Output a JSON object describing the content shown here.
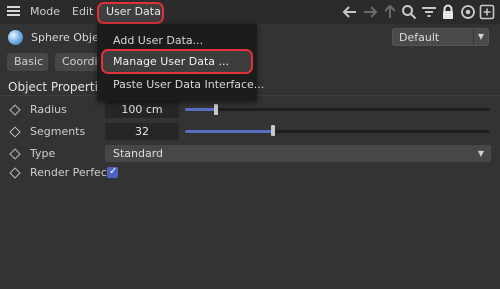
{
  "menubar": {
    "items": [
      {
        "label": "Mode"
      },
      {
        "label": "Edit"
      },
      {
        "label": "User Data"
      }
    ],
    "toolbar_icons": [
      "arrow-left-icon",
      "arrow-right-icon",
      "arrow-up-icon",
      "search-icon",
      "filter-icon",
      "lock-icon",
      "target-icon",
      "add-window-icon"
    ]
  },
  "object": {
    "icon": "sphere-icon",
    "name": "Sphere Object"
  },
  "mode_dropdown": {
    "value": "Default"
  },
  "tabs": [
    {
      "label": "Basic"
    },
    {
      "label": "Coordin"
    }
  ],
  "section": {
    "title": "Object Properties"
  },
  "properties": {
    "radius": {
      "label": "Radius",
      "value": "100 cm",
      "slider_fraction": 0.1
    },
    "segments": {
      "label": "Segments",
      "value": "32",
      "slider_fraction": 0.29
    },
    "type": {
      "label": "Type",
      "value": "Standard"
    },
    "render_perfect": {
      "label": "Render Perfect",
      "checked": true
    }
  },
  "popup_menu": {
    "items": [
      {
        "label": "Add User Data..."
      },
      {
        "label": "Manage User Data ..."
      },
      {
        "label": "Paste User Data Interface..."
      }
    ],
    "highlighted_index": 1
  },
  "colors": {
    "highlight_ring": "#e0303a",
    "slider_fill": "#5a6fc0",
    "checkbox": "#4d62c3",
    "background": "#333333"
  }
}
